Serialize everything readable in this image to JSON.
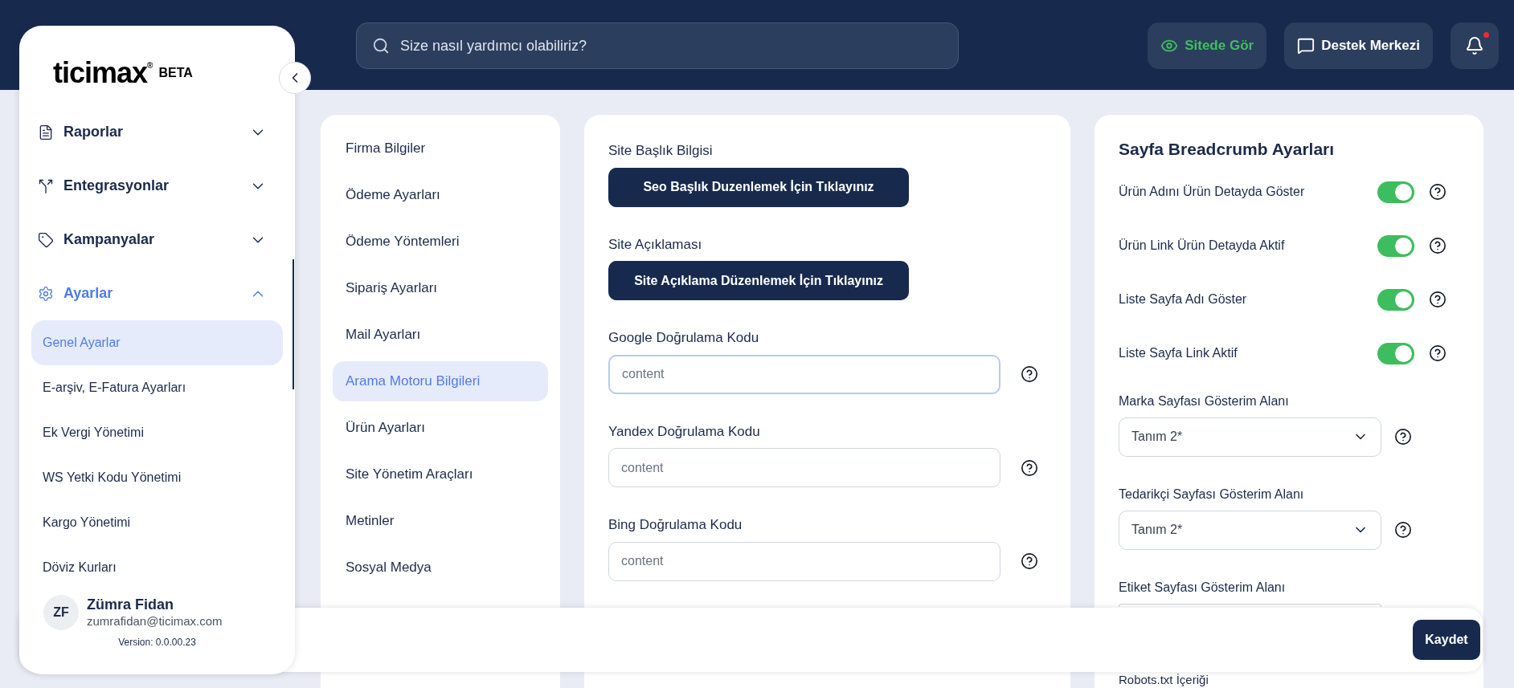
{
  "topbar": {
    "search": {
      "placeholder": "Size nasıl yardımcı olabiliriz?"
    },
    "buttons": [
      {
        "kind": "view",
        "label": "Sitede Gör"
      },
      {
        "kind": "support",
        "label": "Destek Merkezi"
      }
    ],
    "notifications": {
      "unread": true
    }
  },
  "sidebar": {
    "logo": "ticimax",
    "logo_mark": "®",
    "badge": "BETA",
    "nav": [
      {
        "label": "Raporlar",
        "expanded": false
      },
      {
        "label": "Entegrasyonlar",
        "expanded": false
      },
      {
        "label": "Kampanyalar",
        "expanded": false
      },
      {
        "label": "Ayarlar",
        "expanded": true,
        "children": [
          {
            "label": "Genel Ayarlar",
            "selected": true
          },
          {
            "label": "E-arşiv, E-Fatura Ayarları",
            "selected": false
          },
          {
            "label": "Ek Vergi Yönetimi",
            "selected": false
          },
          {
            "label": "WS Yetki Kodu Yönetimi",
            "selected": false
          },
          {
            "label": "Kargo Yönetimi",
            "selected": false
          },
          {
            "label": "Döviz Kurları",
            "selected": false
          }
        ]
      }
    ],
    "user": {
      "initials": "ZF",
      "name": "Zümra Fidan",
      "email": "zumrafidan@ticimax.com"
    },
    "version": "Version: 0.0.00.23"
  },
  "settings_menu": [
    {
      "label": "Firma Bilgiler",
      "selected": false
    },
    {
      "label": "Ödeme Ayarları",
      "selected": false
    },
    {
      "label": "Ödeme Yöntemleri",
      "selected": false
    },
    {
      "label": "Sipariş Ayarları",
      "selected": false
    },
    {
      "label": "Mail Ayarları",
      "selected": false
    },
    {
      "label": "Arama Motoru Bilgileri",
      "selected": true
    },
    {
      "label": "Ürün Ayarları",
      "selected": false
    },
    {
      "label": "Site Yönetim Araçları",
      "selected": false
    },
    {
      "label": "Metinler",
      "selected": false
    },
    {
      "label": "Sosyal Medya",
      "selected": false
    }
  ],
  "seo_form": [
    {
      "kind": "button",
      "label": "Site Başlık Bilgisi",
      "button": "Seo Başlık Duzenlemek İçin Tıklayınız"
    },
    {
      "kind": "button",
      "label": "Site Açıklaması",
      "button": "Site Açıklama Düzenlemek İçin Tıklayınız"
    },
    {
      "kind": "input",
      "label": "Google Doğrulama Kodu",
      "placeholder": "content",
      "focused": true
    },
    {
      "kind": "input",
      "label": "Yandex Doğrulama Kodu",
      "placeholder": "content",
      "focused": false
    },
    {
      "kind": "input",
      "label": "Bing Doğrulama Kodu",
      "placeholder": "content",
      "focused": false
    }
  ],
  "breadcrumb": {
    "title": "Sayfa Breadcrumb Ayarları",
    "settings": [
      {
        "kind": "toggle",
        "label": "Ürün Adını Ürün Detayda Göster",
        "on": true
      },
      {
        "kind": "toggle",
        "label": "Ürün Link Ürün Detayda Aktif",
        "on": true
      },
      {
        "kind": "toggle",
        "label": "Liste Sayfa Adı Göster",
        "on": true
      },
      {
        "kind": "toggle",
        "label": "Liste Sayfa Link Aktif",
        "on": true
      },
      {
        "kind": "select",
        "label": "Marka Sayfası Gösterim Alanı",
        "value": "Tanım 2*"
      },
      {
        "kind": "select",
        "label": "Tedarikçi Sayfası Gösterim Alanı",
        "value": "Tanım 2*"
      },
      {
        "kind": "select",
        "label": "Etiket Sayfası Gösterim Alanı"
      },
      {
        "kind": "label",
        "label": "Robots.txt İçeriği"
      }
    ]
  },
  "save_bar": {
    "button": "Kaydet"
  }
}
